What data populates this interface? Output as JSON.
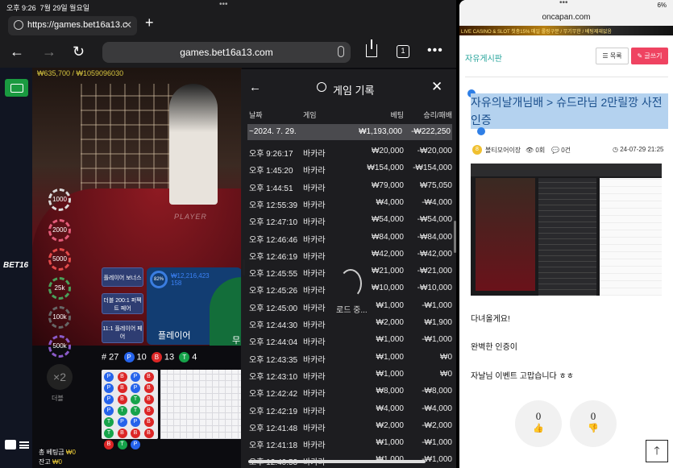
{
  "status_left": {
    "time": "오후 9:26",
    "date": "7월 29일 월요일",
    "dots": "•••"
  },
  "browser": {
    "tab_title": "https://games.bet16a13.c",
    "tab_close": "✕",
    "new_tab": "+",
    "url": "games.bet16a13.com",
    "tabs_count": "1",
    "back": "←",
    "forward": "→",
    "reload": "↻",
    "more": "•••"
  },
  "game": {
    "balance_overlay": "₩635,700 / ₩1059096030",
    "brand": "BET16",
    "chips": [
      "1000",
      "2000",
      "5000",
      "25k",
      "100k",
      "500k"
    ],
    "bp_bonus": "플레이어 보너스",
    "bp_pair_more": "더블 200:1 퍼펙트 페어",
    "bp_pair": "11:1 플레이어 페어",
    "bp_total": "₩12,216,423",
    "bp_count": "158",
    "bp_pct": "82%",
    "player_label": "플레이어",
    "green_label": "무",
    "table_label": "PLAYER",
    "round": "# 27",
    "p_letter": "P",
    "p_count": "10",
    "b_letter": "B",
    "b_count": "13",
    "t_letter": "T",
    "t_count": "4",
    "x2": "×2",
    "x2_label": "더블",
    "total_bet_label": "총 베팅금",
    "total_bet_value": "₩0",
    "remain_label": "잔고",
    "remain_value": "₩0",
    "bead": [
      "P",
      "B",
      "P",
      "B",
      "P",
      "B",
      "P",
      "B",
      "P",
      "B",
      "T",
      "B",
      "P",
      "T",
      "T",
      "B",
      "T",
      "P",
      "P",
      "B",
      "T",
      "B",
      "B",
      "B",
      "B",
      "T",
      "P",
      ""
    ],
    "colors": {
      "player": "#2563eb",
      "banker": "#dc2626",
      "tie": "#16a34a",
      "accent": "#f2d13a"
    }
  },
  "history": {
    "title": "게임 기록",
    "back": "←",
    "close": "✕",
    "columns": [
      "날짜",
      "게임",
      "베팅",
      "승리/패배"
    ],
    "summary": {
      "date": "~2024. 7. 29.",
      "bet": "₩1,193,000",
      "pl": "-₩222,250"
    },
    "rows": [
      {
        "time": "오후 9:26:17",
        "game": "바카라",
        "bet": "₩20,000",
        "pl": "-₩20,000"
      },
      {
        "time": "오후 1:45:20",
        "game": "바카라",
        "bet": "₩154,000",
        "pl": "-₩154,000"
      },
      {
        "time": "오후 1:44:51",
        "game": "바카라",
        "bet": "₩79,000",
        "pl": "₩75,050"
      },
      {
        "time": "오후 12:55:39",
        "game": "바카라",
        "bet": "₩4,000",
        "pl": "-₩4,000"
      },
      {
        "time": "오후 12:47:10",
        "game": "바카라",
        "bet": "₩54,000",
        "pl": "-₩54,000"
      },
      {
        "time": "오후 12:46:46",
        "game": "바카라",
        "bet": "₩84,000",
        "pl": "-₩84,000"
      },
      {
        "time": "오후 12:46:19",
        "game": "바카라",
        "bet": "₩42,000",
        "pl": "-₩42,000"
      },
      {
        "time": "오후 12:45:55",
        "game": "바카라",
        "bet": "₩21,000",
        "pl": "-₩21,000"
      },
      {
        "time": "오후 12:45:26",
        "game": "바카라",
        "bet": "₩10,000",
        "pl": "-₩10,000"
      },
      {
        "time": "오후 12:45:00",
        "game": "바카라",
        "bet": "₩1,000",
        "pl": "-₩1,000"
      },
      {
        "time": "오후 12:44:30",
        "game": "바카라",
        "bet": "₩2,000",
        "pl": "₩1,900"
      },
      {
        "time": "오후 12:44:04",
        "game": "바카라",
        "bet": "₩1,000",
        "pl": "-₩1,000"
      },
      {
        "time": "오후 12:43:35",
        "game": "바카라",
        "bet": "₩1,000",
        "pl": "₩0"
      },
      {
        "time": "오후 12:43:10",
        "game": "바카라",
        "bet": "₩1,000",
        "pl": "₩0"
      },
      {
        "time": "오후 12:42:42",
        "game": "바카라",
        "bet": "₩8,000",
        "pl": "-₩8,000"
      },
      {
        "time": "오후 12:42:19",
        "game": "바카라",
        "bet": "₩4,000",
        "pl": "-₩4,000"
      },
      {
        "time": "오후 12:41:48",
        "game": "바카라",
        "bet": "₩2,000",
        "pl": "-₩2,000"
      },
      {
        "time": "오후 12:41:18",
        "game": "바카라",
        "bet": "₩1,000",
        "pl": "-₩1,000"
      },
      {
        "time": "오후 12:40:53",
        "game": "바카라",
        "bet": "₩1,000",
        "pl": "-₩1,000"
      }
    ],
    "loading": "로드 중..."
  },
  "oncapan": {
    "status_dots": "•••",
    "battery": "6%",
    "url": "oncapan.com",
    "banner": "LIVE CASINO & SLOT 첫충15% 매일 롤링구분 / 무기무한 / 베팅제재없음",
    "board_title": "자유게시판",
    "list_button": "목록",
    "write_button": "글쓰기",
    "post_title": "자유의날개님배 > 슈드라님 2만릴깡 사전인증",
    "author_level": "8",
    "author": "볼티모어이장",
    "views": "0회",
    "comments": "0건",
    "date": "24-07-29 21:25",
    "body": [
      "다녀올게요!",
      "완벽한 인증이",
      "자날님 이벤트 고맙습니다 ㅎㅎ"
    ],
    "upvotes": "0",
    "downvotes": "0",
    "to_top": "🡑",
    "accent": "#24a39a",
    "write_color": "#ef4361"
  }
}
